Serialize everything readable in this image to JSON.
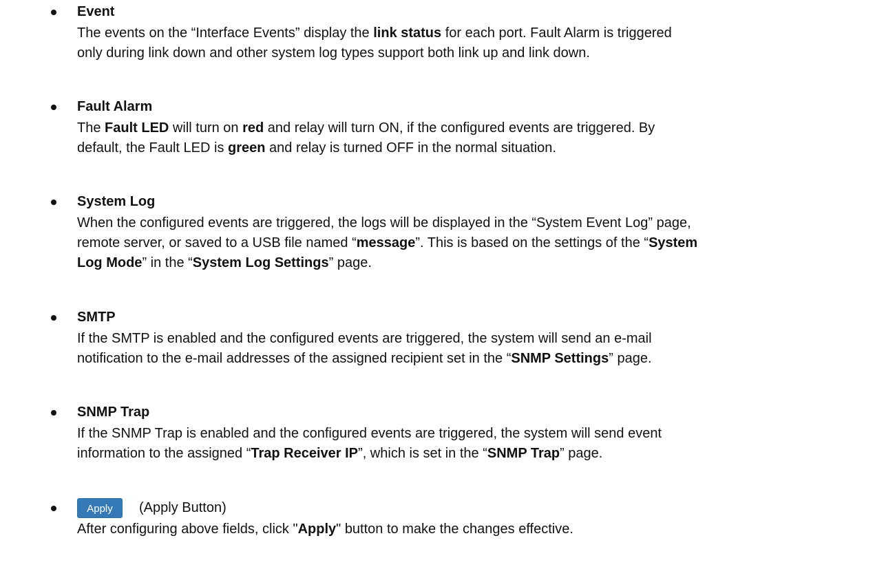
{
  "items": {
    "event": {
      "title": "Event",
      "l1": [
        "The events on the “Interface Events” display the ",
        "link status",
        " for each port. Fault Alarm is triggered"
      ],
      "l2": "only during link down and other system log types support both link up and link down."
    },
    "fault_alarm": {
      "title": "Fault Alarm",
      "l1": [
        "The ",
        "Fault LED",
        " will turn on ",
        "red",
        " and relay will turn ON, if the configured events are triggered. By"
      ],
      "l2": [
        "default, the Fault LED is ",
        "green",
        " and relay is turned OFF in the normal situation."
      ]
    },
    "system_log": {
      "title": "System Log",
      "l1": "When the configured events are triggered, the logs will be displayed in the “System Event Log” page,",
      "l2": [
        "remote server, or saved to a USB file named “",
        "message",
        "”. This is based on the settings of the “",
        "System"
      ],
      "l3": [
        "Log Mode",
        "” in the “",
        "System Log Settings",
        "” page."
      ]
    },
    "smtp": {
      "title": "SMTP",
      "l1": "If the SMTP is enabled and the configured events are triggered, the system will send an e-mail",
      "l2": [
        "notification to the e-mail addresses of the assigned recipient set in the “",
        "SNMP Settings",
        "” page."
      ]
    },
    "snmp_trap": {
      "title": "SNMP Trap",
      "l1": "If the SNMP Trap is enabled and the configured events are triggered, the system will send event",
      "l2": [
        "information to the assigned “",
        "Trap Receiver IP",
        "”, which is set in the “",
        "SNMP Trap",
        "” page."
      ]
    },
    "apply": {
      "button_label": "Apply",
      "note": "(Apply Button)",
      "l1": [
        "After configuring above fields, click \"",
        "Apply",
        "\" button to make the changes effective."
      ]
    }
  },
  "colors": {
    "apply_button": "#337ab7",
    "text": "#111111"
  }
}
